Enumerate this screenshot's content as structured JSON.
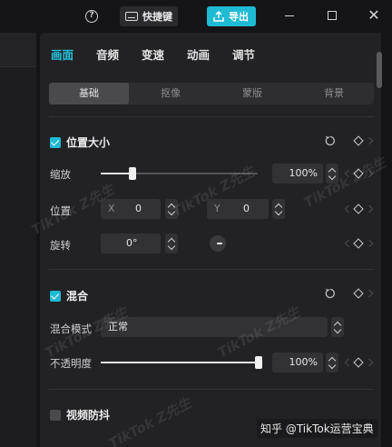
{
  "titlebar": {
    "help_glyph": "?",
    "shortcut_label": "快捷键",
    "export_label": "导出",
    "close_glyph": "✕"
  },
  "tabs": [
    {
      "label": "画面",
      "active": true
    },
    {
      "label": "音频",
      "active": false
    },
    {
      "label": "变速",
      "active": false
    },
    {
      "label": "动画",
      "active": false
    },
    {
      "label": "调节",
      "active": false
    }
  ],
  "subtabs": [
    {
      "label": "基础",
      "active": true
    },
    {
      "label": "抠像",
      "active": false
    },
    {
      "label": "蒙版",
      "active": false
    },
    {
      "label": "背景",
      "active": false
    }
  ],
  "position_section": {
    "title": "位置大小",
    "checked": true,
    "scale_label": "缩放",
    "scale_value": "100%",
    "scale_fraction": 0.2,
    "position_label": "位置",
    "x_prefix": "X",
    "x_value": "0",
    "y_prefix": "Y",
    "y_value": "0",
    "rotate_label": "旋转",
    "rotate_value": "0°"
  },
  "blend_section": {
    "title": "混合",
    "checked": true,
    "mode_label": "混合模式",
    "mode_value": "正常",
    "opacity_label": "不透明度",
    "opacity_value": "100%",
    "opacity_fraction": 1.0
  },
  "stabilize_section": {
    "title": "视频防抖",
    "checked": false
  },
  "watermark_text": "TikTok Z先生",
  "credit_text": "知乎 @TikTok运营宝典",
  "colors": {
    "accent": "#1fbad3",
    "panel_bg": "#222225",
    "app_bg": "#141416"
  }
}
